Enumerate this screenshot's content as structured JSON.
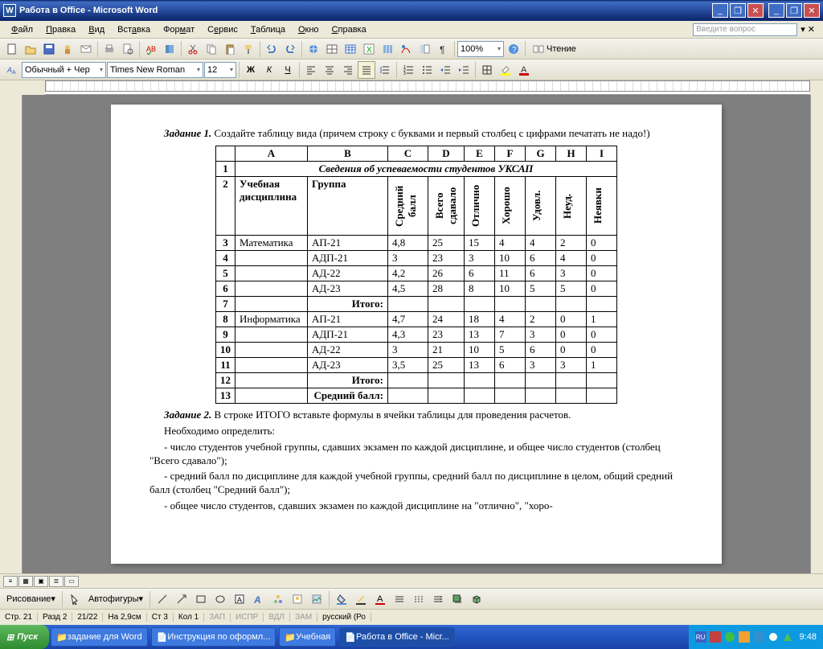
{
  "titlebar": {
    "title": "Работа в Office - Microsoft Word"
  },
  "menubar": {
    "items": [
      "Файл",
      "Правка",
      "Вид",
      "Вставка",
      "Формат",
      "Сервис",
      "Таблица",
      "Окно",
      "Справка"
    ],
    "help_placeholder": "Введите вопрос"
  },
  "toolbar1": {
    "zoom": "100%",
    "reading": "Чтение"
  },
  "toolbar2": {
    "style": "Обычный + Чер",
    "font": "Times New Roman",
    "size": "12"
  },
  "drawbar": {
    "drawing": "Рисование",
    "autoshapes": "Автофигуры"
  },
  "document": {
    "task1_label": "Задание 1.",
    "task1_text": " Создайте таблицу вида (причем строку с буквами и первый столбец с цифрами печатать не надо!)",
    "table": {
      "col_letters": [
        "A",
        "B",
        "C",
        "D",
        "E",
        "F",
        "G",
        "H",
        "I"
      ],
      "title_row": "Сведения об успеваемости студентов УКСАП",
      "headers": {
        "discipline": "Учебная дисциплина",
        "group": "Группа",
        "avg": "Средний балл",
        "total": "Всего сдавало",
        "excellent": "Отлично",
        "good": "Хорошо",
        "sat": "Удовл.",
        "unsat": "Неуд.",
        "absent": "Неявки"
      },
      "rows": [
        {
          "n": "3",
          "disc": "Математика",
          "grp": "АП-21",
          "c": "4,8",
          "d": "25",
          "e": "15",
          "f": "4",
          "g": "4",
          "h": "2",
          "i": "0"
        },
        {
          "n": "4",
          "disc": "",
          "grp": "АДП-21",
          "c": "3",
          "d": "23",
          "e": "3",
          "f": "10",
          "g": "6",
          "h": "4",
          "i": "0"
        },
        {
          "n": "5",
          "disc": "",
          "grp": "АД-22",
          "c": "4,2",
          "d": "26",
          "e": "6",
          "f": "11",
          "g": "6",
          "h": "3",
          "i": "0"
        },
        {
          "n": "6",
          "disc": "",
          "grp": "АД-23",
          "c": "4,5",
          "d": "28",
          "e": "8",
          "f": "10",
          "g": "5",
          "h": "5",
          "i": "0"
        },
        {
          "n": "8",
          "disc": "Информатика",
          "grp": "АП-21",
          "c": "4,7",
          "d": "24",
          "e": "18",
          "f": "4",
          "g": "2",
          "h": "0",
          "i": "1"
        },
        {
          "n": "9",
          "disc": "",
          "grp": "АДП-21",
          "c": "4,3",
          "d": "23",
          "e": "13",
          "f": "7",
          "g": "3",
          "h": "0",
          "i": "0"
        },
        {
          "n": "10",
          "disc": "",
          "grp": "АД-22",
          "c": "3",
          "d": "21",
          "e": "10",
          "f": "5",
          "g": "6",
          "h": "0",
          "i": "0"
        },
        {
          "n": "11",
          "disc": "",
          "grp": "АД-23",
          "c": "3,5",
          "d": "25",
          "e": "13",
          "f": "6",
          "g": "3",
          "h": "3",
          "i": "1"
        }
      ],
      "itogo": "Итого:",
      "avg_label": "Средний балл:"
    },
    "task2_label": "Задание 2.",
    "task2_text": " В строке ИТОГО вставьте формулы в ячейки таблицы для проведения расчетов.",
    "need": "Необходимо определить:",
    "b1": "- число студентов учебной группы, сдавших экзамен по каждой дисциплине, и общее число студентов (столбец \"Всего сдавало\");",
    "b2": "- средний балл по дисциплине для каждой учебной группы, средний балл по дисциплине в целом, общий средний балл (столбец \"Средний балл\");",
    "b3": "- общее число студентов, сдавших экзамен по каждой дисциплине на \"отлично\", \"хоро-"
  },
  "statusbar": {
    "page": "Стр. 21",
    "sect": "Разд 2",
    "pages": "21/22",
    "at": "На 2,9см",
    "ln": "Ст 3",
    "col": "Кол 1",
    "rec": "ЗАП",
    "trk": "ИСПР",
    "ext": "ВДЛ",
    "ovr": "ЗАМ",
    "lang": "русский (Ро"
  },
  "taskbar": {
    "start": "Пуск",
    "tasks": [
      "задание для Word",
      "Инструкция по оформл...",
      "Учебная",
      "Работа в Office - Micr..."
    ],
    "lang": "RU",
    "clock": "9:48"
  }
}
